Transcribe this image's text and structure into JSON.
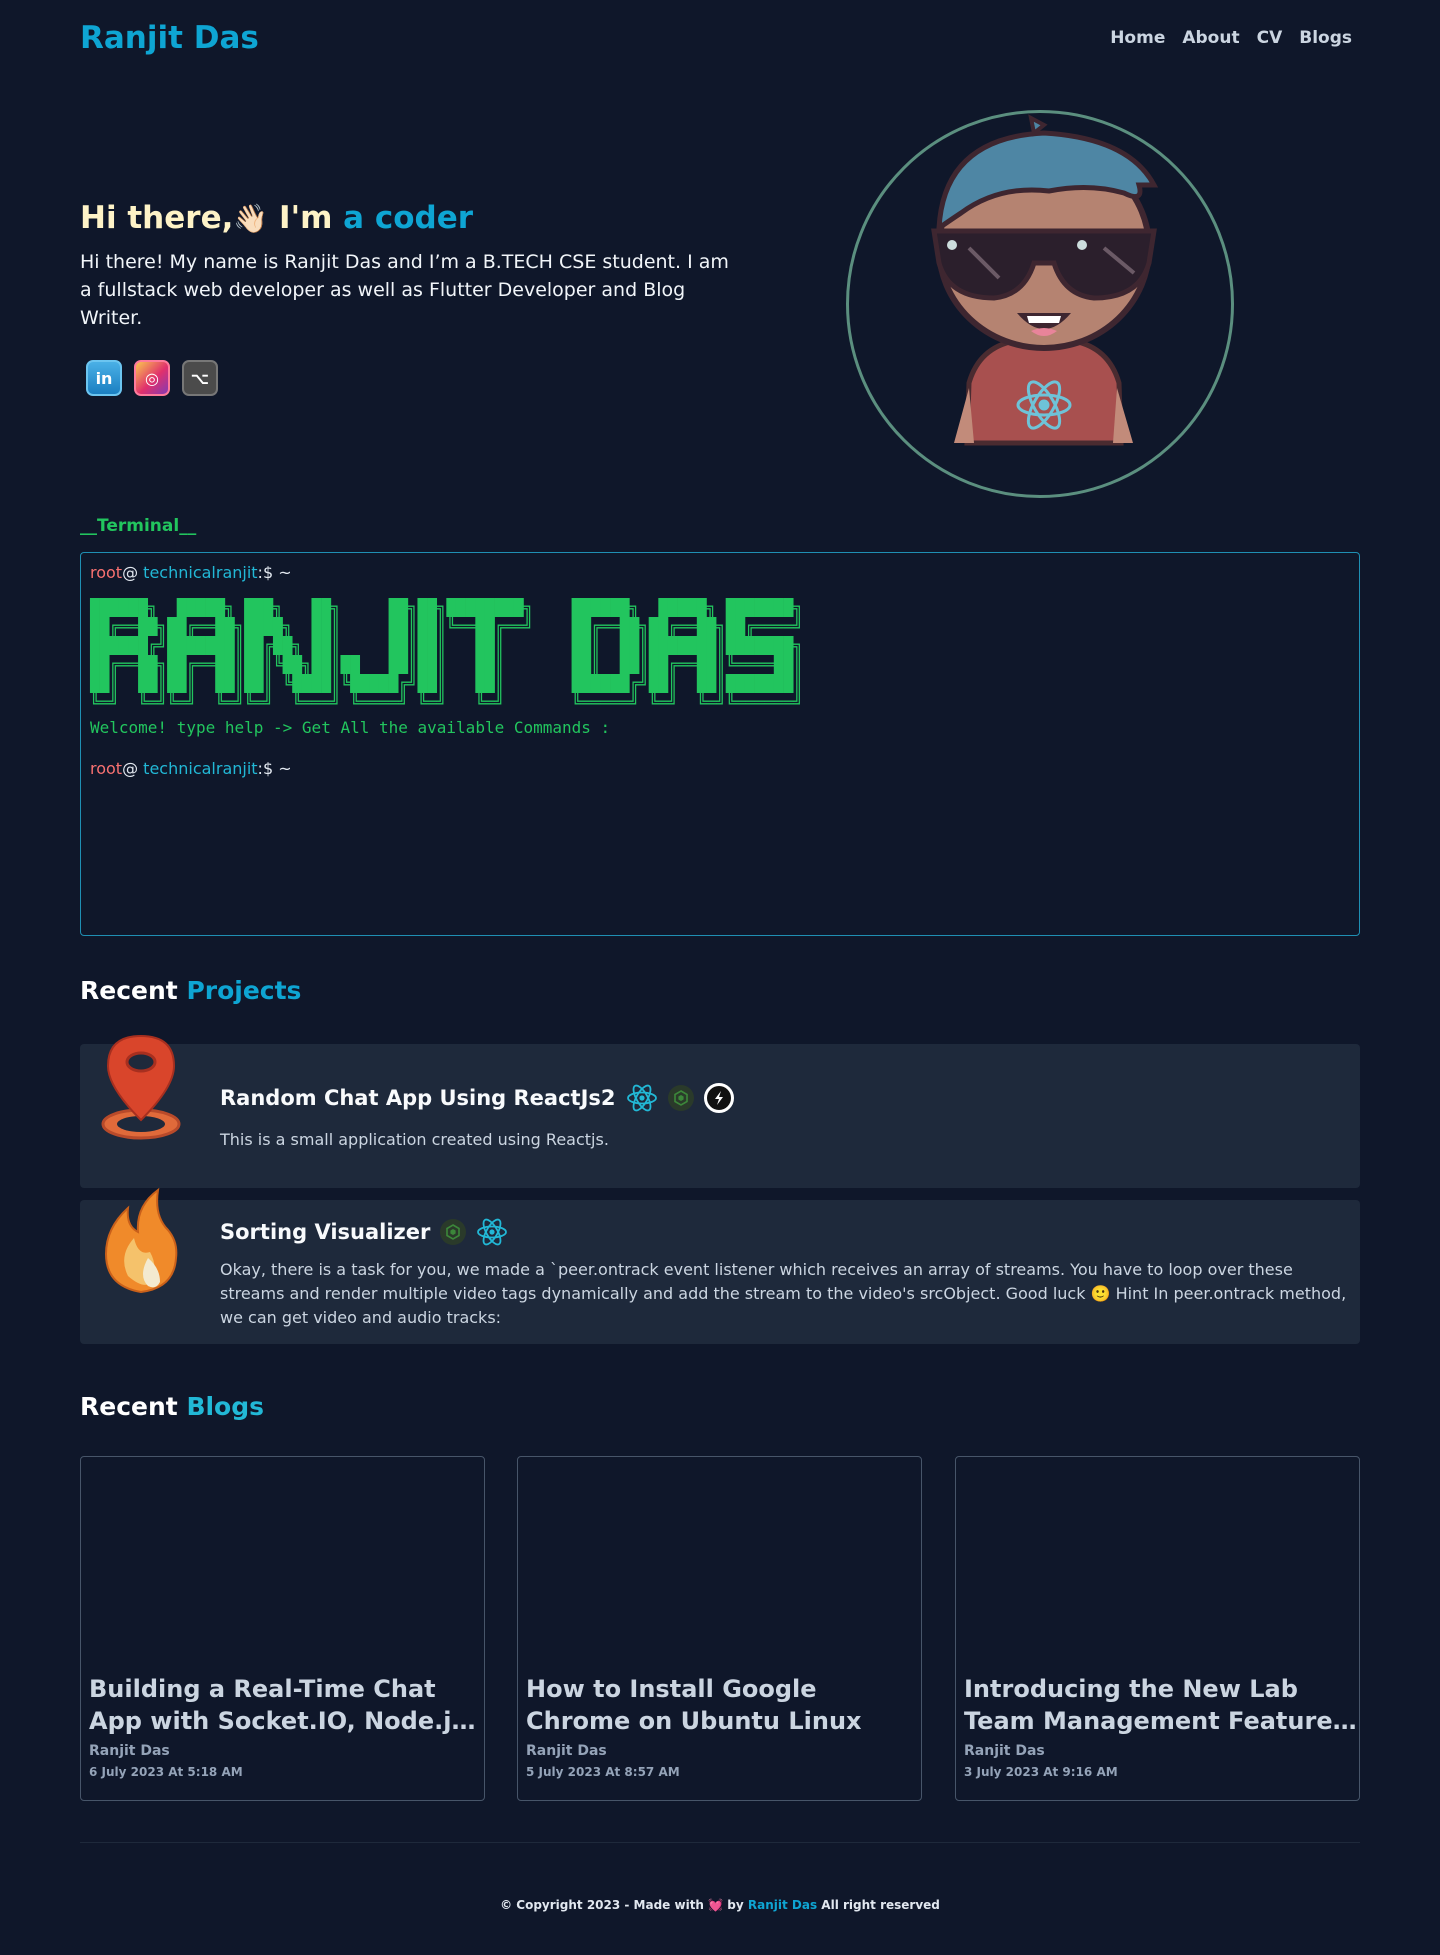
{
  "header": {
    "brand": "Ranjit Das",
    "nav": [
      "Home",
      "About",
      "CV",
      "Blogs"
    ]
  },
  "hero": {
    "greeting": "Hi there,",
    "wave": "👋🏻",
    "im": " I'm ",
    "role": "a coder",
    "bio": "Hi there! My name is Ranjit Das and I’m a B.TECH CSE student. I am a fullstack web developer as well as Flutter Developer and Blog Writer.",
    "socials": [
      {
        "icon": "linkedin-icon",
        "text": "in"
      },
      {
        "icon": "instagram-icon",
        "text": "◎"
      },
      {
        "icon": "github-icon",
        "text": "⌥"
      }
    ]
  },
  "terminal": {
    "label": "__Terminal__",
    "user": "root",
    "at": "@ ",
    "host": "technicalranjit",
    "suffix": ":$ ~",
    "ascii": "██████╗  █████╗ ███╗   ██╗     ██╗██╗████████╗    ██████╗  █████╗ ███████╗\n██╔══██╗██╔══██╗████╗  ██║     ██║██║╚══██╔══╝    ██╔══██╗██╔══██╗██╔════╝\n██████╔╝███████║██╔██╗ ██║     ██║██║   ██║       ██║  ██║███████║███████╗\n██╔══██╗██╔══██║██║╚██╗██║██   ██║██║   ██║       ██║  ██║██╔══██║╚════██║\n██║  ██║██║  ██║██║ ╚████║╚█████╔╝██║   ██║       ██████╔╝██║  ██║███████║\n╚═╝  ╚═╝╚═╝  ╚═╝╚═╝  ╚═══╝ ╚════╝ ╚═╝   ╚═╝       ╚═════╝ ╚═╝  ╚═╝╚══════╝",
    "welcome": "Welcome! type help -> Get All the available Commands :"
  },
  "projects": {
    "title_plain": "Recent ",
    "title_accent": "Projects",
    "items": [
      {
        "title": "Random Chat App Using ReactJs2",
        "desc": "This is a small application created using Reactjs.",
        "icon": "location-pin-icon",
        "tech": [
          "react-icon",
          "nodejs-icon",
          "nextjs-icon"
        ]
      },
      {
        "title": "Sorting Visualizer",
        "desc": "Okay, there is a task for you, we made a `peer.ontrack event listener which receives an array of streams. You have to loop over these streams and render multiple video tags dynamically and add the stream to the video's srcObject. Good luck 🙂 Hint In peer.ontrack method, we can get video and audio tracks:",
        "icon": "fire-icon",
        "tech": [
          "nodejs-icon",
          "react-icon"
        ]
      }
    ]
  },
  "blogs": {
    "title_plain": "Recent ",
    "title_accent": "Blogs",
    "items": [
      {
        "title": "Building a Real-Time Chat App with Socket.IO, Node.js, and React",
        "author": "Ranjit Das",
        "date": "6 July 2023 At 5:18 AM"
      },
      {
        "title": "How to Install Google Chrome on Ubuntu Linux",
        "author": "Ranjit Das",
        "date": "5 July 2023 At 8:57 AM"
      },
      {
        "title": "Introducing the New Lab Team Management Feature in Our App",
        "author": "Ranjit Das",
        "date": "3 July 2023 At 9:16 AM"
      }
    ]
  },
  "footer": {
    "pre": "© Copyright 2023 - Made with ",
    "heart": "💓",
    "by": " by ",
    "name": "Ranjit Das",
    "post": " All right reserved"
  },
  "colors": {
    "background": "#0f172a",
    "accent": "#0ea5d3",
    "terminal_green": "#22c55e",
    "card": "#1e293b"
  }
}
